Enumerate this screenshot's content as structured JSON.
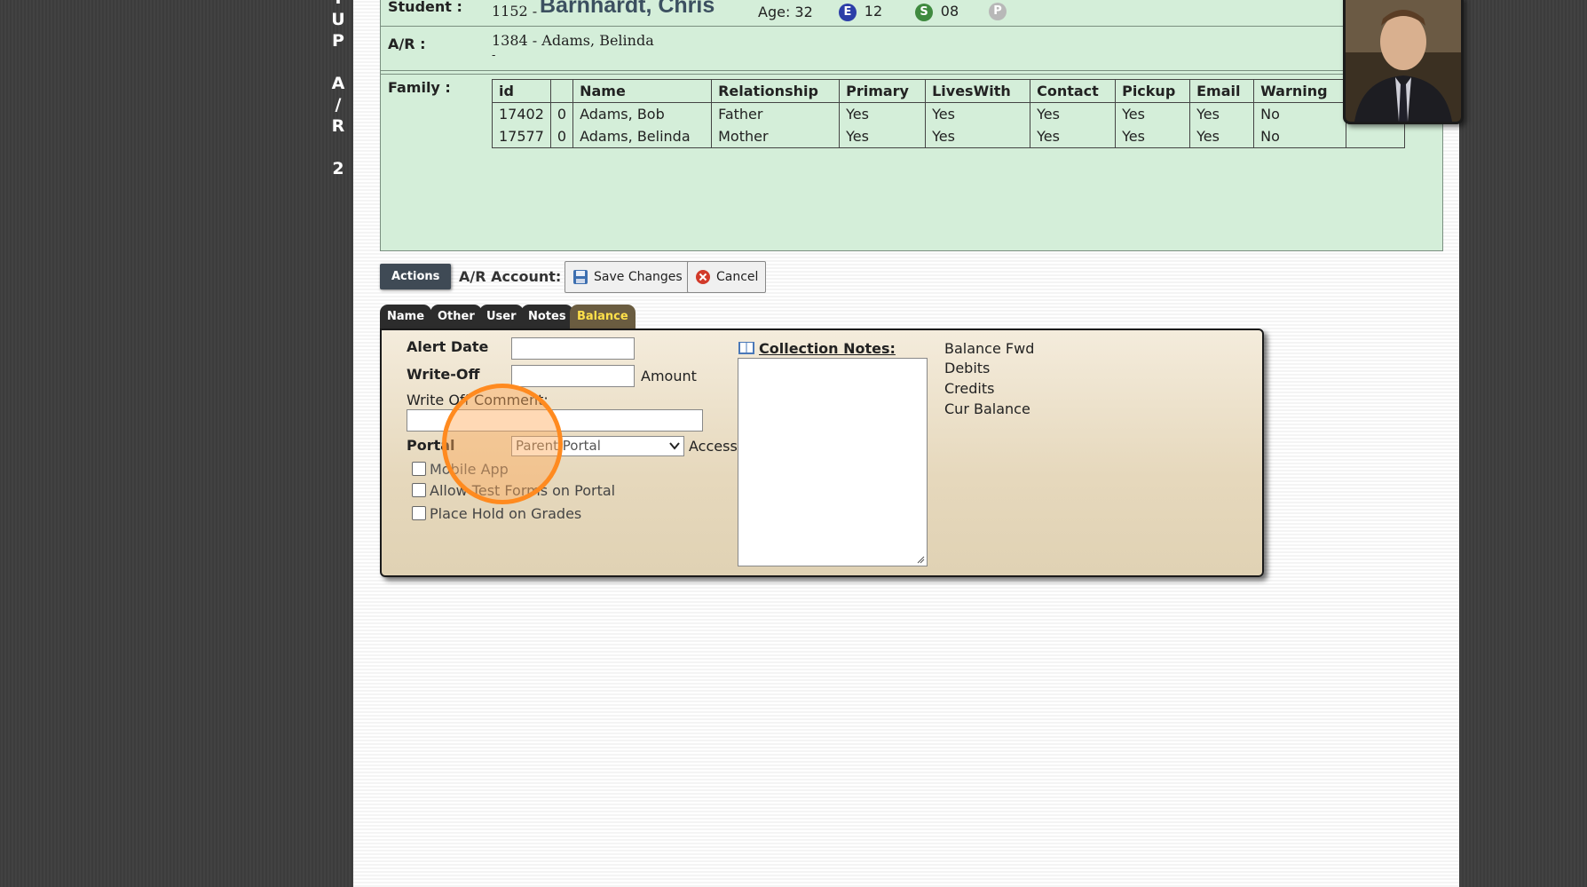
{
  "vertical_tab": [
    "T",
    "U",
    "P",
    "",
    "A",
    "/",
    "R",
    "",
    "2"
  ],
  "student": {
    "label": "Student :",
    "id_prefix": "1152 -",
    "name": "Barnhardt, Chris",
    "age": "Age: 32",
    "badge_e": "E",
    "grade": "12",
    "badge_s": "S",
    "section": "08",
    "badge_p": "P"
  },
  "ar": {
    "label": "A/R :",
    "value": "1384 - Adams, Belinda",
    "sub": "-"
  },
  "family": {
    "label": "Family :",
    "headers": [
      "id",
      "",
      "Name",
      "Relationship",
      "Primary",
      "LivesWith",
      "Contact",
      "Pickup",
      "Email",
      "Warning",
      ""
    ],
    "rows": [
      [
        "17402",
        "0",
        "Adams, Bob",
        "Father",
        "Yes",
        "Yes",
        "Yes",
        "Yes",
        "Yes",
        "No",
        ""
      ],
      [
        "17577",
        "0",
        "Adams, Belinda",
        "Mother",
        "Yes",
        "Yes",
        "Yes",
        "Yes",
        "Yes",
        "No",
        ""
      ]
    ]
  },
  "actions": {
    "actions_label": "Actions",
    "account_label": "A/R Account:",
    "save_label": "Save Changes",
    "cancel_label": "Cancel"
  },
  "tabs": [
    "Name",
    "Other",
    "User",
    "Notes",
    "Balance"
  ],
  "form": {
    "alert_date": "Alert Date",
    "write_off": "Write-Off",
    "amount": "Amount",
    "write_off_comment": "Write Off Comment:",
    "portal": "Portal",
    "portal_select": "Parent Portal",
    "access": "Access",
    "mobile_app": "Mobile App",
    "allow_test_forms": "Allow Test Forms on Portal",
    "place_hold": "Place Hold on Grades",
    "collection_notes": "Collection Notes:",
    "balance_fwd": "Balance Fwd",
    "debits": "Debits",
    "credits": "Credits",
    "cur_balance": "Cur Balance"
  },
  "colors": {
    "info_panel": "#d4eed9",
    "active_tab_text": "#ffe04a",
    "cursor_ring": "#ff8a1f"
  }
}
